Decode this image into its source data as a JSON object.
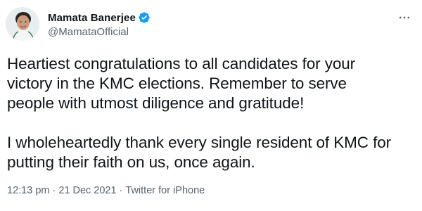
{
  "author": {
    "display_name": "Mamata Banerjee",
    "handle": "@MamataOfficial",
    "verified": true,
    "verified_color": "#1d9bf0"
  },
  "tweet": {
    "paragraph_1": "Heartiest congratulations to all candidates for your\nvictory in the KMC elections. Remember to serve\npeople with utmost diligence and gratitude!",
    "paragraph_2": "I wholeheartedly thank every single resident of KMC for\nputting their faith on us, once again."
  },
  "meta": {
    "time": "12:13 pm",
    "separator": "·",
    "date": "21 Dec 2021",
    "source": "Twitter for iPhone"
  },
  "icons": {
    "more": "more-horizontal-icon",
    "verified": "verified-badge-icon"
  },
  "colors": {
    "text_primary": "#0f1419",
    "text_secondary": "#536471",
    "background": "#ffffff"
  }
}
